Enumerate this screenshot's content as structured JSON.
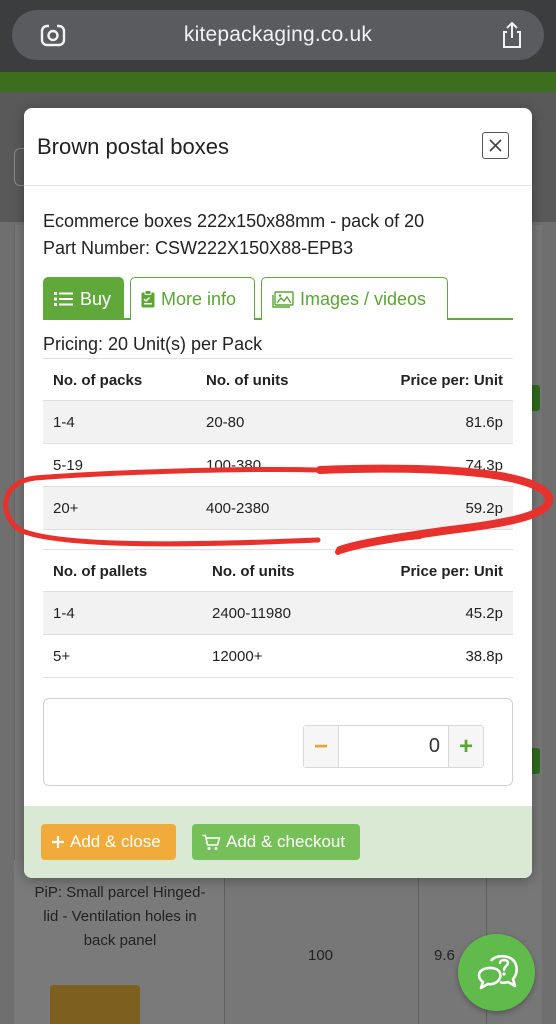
{
  "browser": {
    "url": "kitepackaging.co.uk"
  },
  "background": {
    "product_text": "PiP: Small parcel Hinged-lid - Ventilation holes in back panel",
    "quantity": "100",
    "price_partial": "9.6"
  },
  "modal": {
    "title": "Brown postal boxes",
    "product_line": "Ecommerce boxes 222x150x88mm - pack of 20",
    "part_number_line": "Part Number: CSW222X150X88-EPB3",
    "tabs": [
      {
        "label": "Buy",
        "active": true
      },
      {
        "label": "More info",
        "active": false
      },
      {
        "label": "Images / videos",
        "active": false
      }
    ],
    "pricing_label": "Pricing: 20 Unit(s) per Pack",
    "packs_table": {
      "headers": [
        "No. of packs",
        "No. of units",
        "Price per: Unit"
      ],
      "rows": [
        [
          "1-4",
          "20-80",
          "81.6p"
        ],
        [
          "5-19",
          "100-380",
          "74.3p"
        ],
        [
          "20+",
          "400-2380",
          "59.2p"
        ]
      ]
    },
    "pallets_table": {
      "headers": [
        "No. of pallets",
        "No. of units",
        "Price per: Unit"
      ],
      "rows": [
        [
          "1-4",
          "2400-11980",
          "45.2p"
        ],
        [
          "5+",
          "12000+",
          "38.8p"
        ]
      ]
    },
    "quantity": {
      "minus": "−",
      "value": "0",
      "plus": "+"
    },
    "footer": {
      "add_close": "Add & close",
      "add_checkout": "Add & checkout"
    }
  },
  "colors": {
    "brand_green": "#61a83b",
    "add_close_orange": "#f0ab3a",
    "checkout_green": "#76c05a",
    "annotation_red": "#e8302c",
    "chat_green": "#61ba4c"
  },
  "icons": {
    "camera_lens": "lens-search-icon",
    "share": "share-icon",
    "close": "close-icon",
    "buy": "list-icon",
    "more_info": "clipboard-check-icon",
    "images": "image-icon",
    "cart": "cart-icon",
    "chat": "chat-help-icon"
  }
}
